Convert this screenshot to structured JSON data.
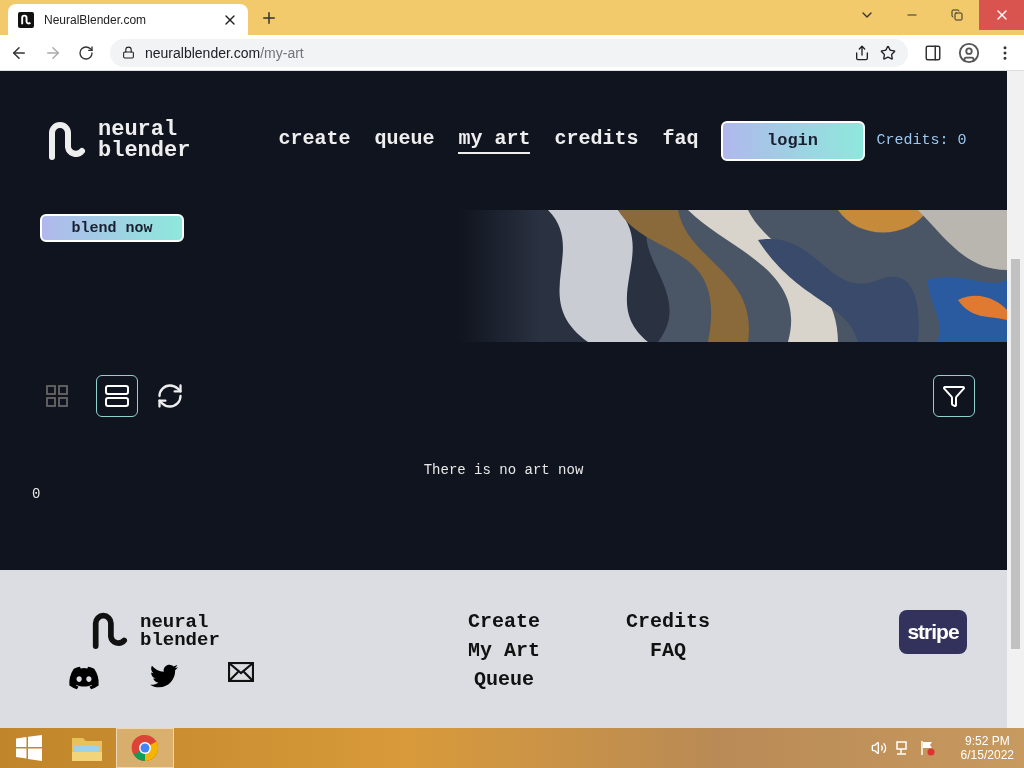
{
  "browser": {
    "tab_title": "NeuralBlender.com",
    "url_host": "neuralblender.com",
    "url_path": "/my-art"
  },
  "header": {
    "logo_lines": [
      "neural",
      "blender"
    ],
    "nav": [
      {
        "label": "create",
        "selected": false
      },
      {
        "label": "queue",
        "selected": false
      },
      {
        "label": "my art",
        "selected": true
      },
      {
        "label": "credits",
        "selected": false
      },
      {
        "label": "faq",
        "selected": false
      }
    ],
    "login": "login",
    "credits": "Credits: 0"
  },
  "hero": {
    "button": "blend now"
  },
  "toolbar": {
    "view_modes": [
      {
        "kind": "grid",
        "selected": false
      },
      {
        "kind": "list",
        "selected": true
      }
    ]
  },
  "empty_message": "There is no art now",
  "count": "0",
  "footer": {
    "logo_lines": [
      "neural",
      "blender"
    ],
    "link_columns": [
      [
        "Create",
        "My Art",
        "Queue"
      ],
      [
        "Credits",
        "FAQ"
      ]
    ],
    "payment_badge": "stripe"
  },
  "taskbar": {
    "time": "9:52 PM",
    "date": "6/15/2022"
  }
}
